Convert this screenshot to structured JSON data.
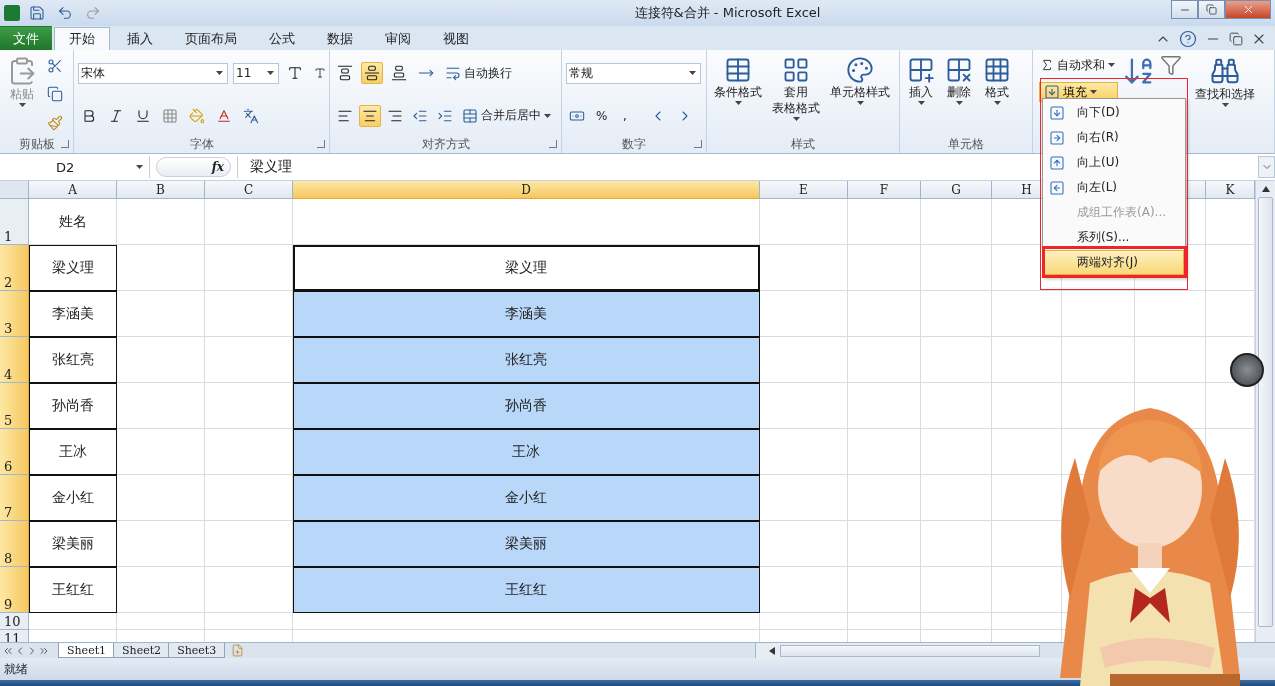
{
  "window": {
    "title": "连接符&合并  -  Microsoft Excel"
  },
  "ribbon_tabs": [
    {
      "label": "文件",
      "kind": "file",
      "selected": false
    },
    {
      "label": "开始",
      "kind": "tab",
      "selected": true
    },
    {
      "label": "插入",
      "kind": "tab",
      "selected": false
    },
    {
      "label": "页面布局",
      "kind": "tab",
      "selected": false
    },
    {
      "label": "公式",
      "kind": "tab",
      "selected": false
    },
    {
      "label": "数据",
      "kind": "tab",
      "selected": false
    },
    {
      "label": "审阅",
      "kind": "tab",
      "selected": false
    },
    {
      "label": "视图",
      "kind": "tab",
      "selected": false
    }
  ],
  "ribbon": {
    "clipboard": {
      "label": "剪贴板",
      "paste": "粘贴"
    },
    "font": {
      "label": "字体",
      "font_name": "宋体",
      "font_size": "11"
    },
    "alignment": {
      "label": "对齐方式",
      "wrap_text": "自动换行",
      "merge": "合并后居中",
      "middle_align_on": true,
      "center_align_on": true
    },
    "number": {
      "label": "数字",
      "format": "常规",
      "percent": "%",
      "comma": ","
    },
    "styles": {
      "label": "样式",
      "buttons": [
        {
          "kind": "conditional",
          "lines": [
            "条件格式"
          ]
        },
        {
          "kind": "table",
          "lines": [
            "套用",
            "表格格式"
          ]
        },
        {
          "kind": "cellstyle",
          "lines": [
            "单元格样式"
          ]
        }
      ]
    },
    "cells": {
      "label": "单元格",
      "buttons": [
        {
          "kind": "insert",
          "lines": [
            "插入"
          ]
        },
        {
          "kind": "delete",
          "lines": [
            "删除"
          ]
        },
        {
          "kind": "format",
          "lines": [
            "格式"
          ]
        }
      ]
    },
    "editing": {
      "autosum": "自动求和",
      "fill": "填充",
      "fill_open": true,
      "find": "查找和选择"
    }
  },
  "formula_bar": {
    "name_box": "D2",
    "fx": "fx",
    "value": "梁义理"
  },
  "sheet": {
    "columns": [
      {
        "label": "A",
        "selected": false
      },
      {
        "label": "B",
        "selected": false
      },
      {
        "label": "C",
        "selected": false
      },
      {
        "label": "D",
        "selected": true
      },
      {
        "label": "E",
        "selected": false
      },
      {
        "label": "F",
        "selected": false
      },
      {
        "label": "G",
        "selected": false
      },
      {
        "label": "H",
        "selected": false
      },
      {
        "label": "K",
        "selected": false
      }
    ],
    "rows": [
      {
        "label": "1",
        "selected": false,
        "boxed": false,
        "a": "姓名"
      },
      {
        "label": "2",
        "selected": true,
        "boxed": true,
        "a": "梁义理",
        "d": "梁义理"
      },
      {
        "label": "3",
        "selected": true,
        "boxed": true,
        "a": "李涵美",
        "d": "李涵美"
      },
      {
        "label": "4",
        "selected": true,
        "boxed": true,
        "a": "张红亮",
        "d": "张红亮"
      },
      {
        "label": "5",
        "selected": true,
        "boxed": true,
        "a": "孙尚香",
        "d": "孙尚香"
      },
      {
        "label": "6",
        "selected": true,
        "boxed": true,
        "a": "王冰",
        "d": "王冰"
      },
      {
        "label": "7",
        "selected": true,
        "boxed": true,
        "a": "金小红",
        "d": "金小红"
      },
      {
        "label": "8",
        "selected": true,
        "boxed": true,
        "a": "梁美丽",
        "d": "梁美丽"
      },
      {
        "label": "9",
        "selected": true,
        "boxed": true,
        "a": "王红红",
        "d": "王红红"
      },
      {
        "label": "10",
        "selected": false,
        "boxed": false
      },
      {
        "label": "11",
        "selected": false,
        "boxed": false
      }
    ]
  },
  "fill_menu": {
    "framed": true,
    "items": [
      {
        "label": "向下(D)",
        "kind": "down",
        "disabled": false,
        "selected": false
      },
      {
        "label": "向右(R)",
        "kind": "right",
        "disabled": false,
        "selected": false
      },
      {
        "label": "向上(U)",
        "kind": "up",
        "disabled": false,
        "selected": false
      },
      {
        "label": "向左(L)",
        "kind": "left",
        "disabled": false,
        "selected": false
      },
      {
        "label": "成组工作表(A)...",
        "kind": "plain",
        "disabled": true,
        "selected": false
      },
      {
        "label": "系列(S)...",
        "kind": "plain",
        "disabled": false,
        "selected": false
      },
      {
        "label": "两端对齐(J)",
        "kind": "plain",
        "disabled": false,
        "selected": true
      }
    ]
  },
  "sheet_tabs": [
    {
      "label": "Sheet1",
      "selected": true
    },
    {
      "label": "Sheet2",
      "selected": false
    },
    {
      "label": "Sheet3",
      "selected": false
    }
  ],
  "status_bar": {
    "text": "就绪"
  }
}
